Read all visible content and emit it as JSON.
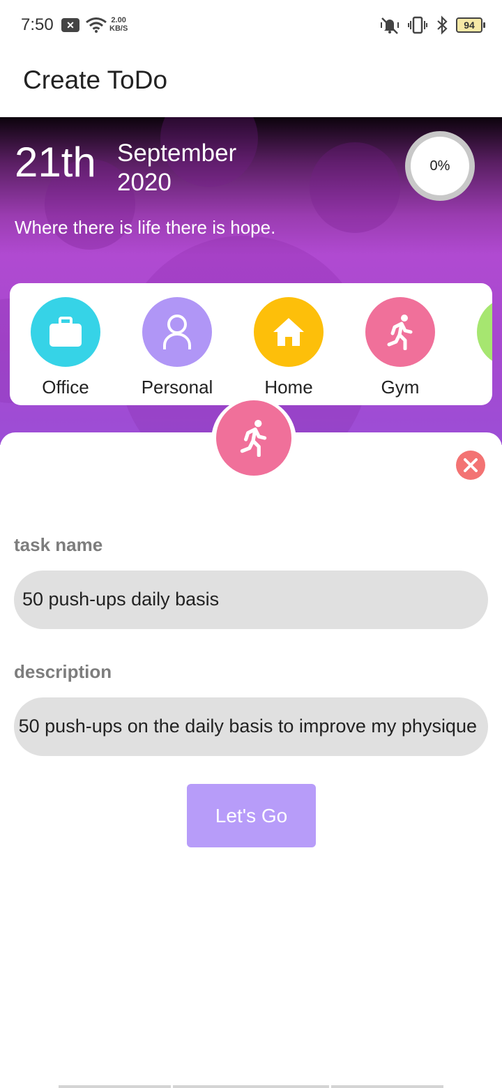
{
  "status_bar": {
    "time": "7:50",
    "net_speed_value": "2.00",
    "net_speed_unit": "KB/S",
    "battery": "94"
  },
  "app_bar": {
    "title": "Create ToDo"
  },
  "hero": {
    "day": "21th",
    "month": "September",
    "year": "2020",
    "progress_label": "0%",
    "progress_value": 0,
    "quote": "Where there is life there is hope."
  },
  "categories": [
    {
      "label": "Office",
      "icon": "briefcase-icon",
      "color": "#36d3e7"
    },
    {
      "label": "Personal",
      "icon": "person-icon",
      "color": "#b096f6"
    },
    {
      "label": "Home",
      "icon": "home-icon",
      "color": "#fdbf0a"
    },
    {
      "label": "Gym",
      "icon": "running-icon",
      "color": "#f0709a"
    },
    {
      "label": "",
      "icon": "category-icon",
      "color": "#a6e670"
    }
  ],
  "selected_category": {
    "icon": "running-icon",
    "color": "#f0709a"
  },
  "form": {
    "task_name_label": "task name",
    "task_name_value": "50 push-ups daily basis",
    "description_label": "description",
    "description_value": "50 push-ups on the daily basis to improve my physique",
    "submit_label": "Let's Go"
  },
  "colors": {
    "accent": "#b79cf9",
    "close": "#f37373",
    "field_bg": "#e0e0e0"
  }
}
